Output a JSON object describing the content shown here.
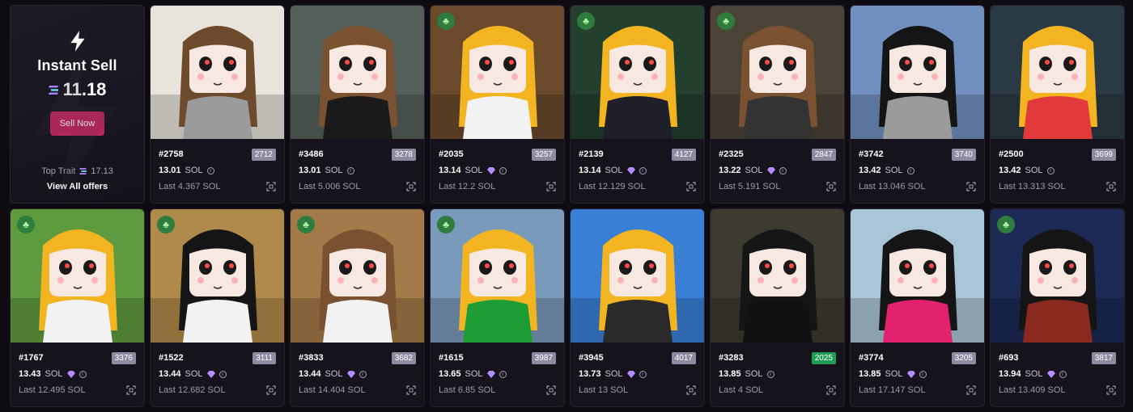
{
  "instant_sell": {
    "title": "Instant Sell",
    "price": "11.18",
    "button_label": "Sell Now",
    "top_trait_label": "Top Trait",
    "top_trait_value": "17.13",
    "view_all_label": "View All offers"
  },
  "colors": {
    "background": "#0e0b13",
    "card": "#17131d",
    "accent_button": "#c2265f",
    "rank_badge": "#8f8aa0",
    "rank_badge_green": "#1f9d55",
    "clover_badge": "#2e7d3e",
    "gem": "#b78cff"
  },
  "icons": {
    "bolt": "lightning-bolt-icon",
    "sol": "solana-icon",
    "gem": "diamond-icon",
    "info": "info-icon",
    "scan": "scan-icon",
    "clover": "clover-icon"
  },
  "cards": [
    {
      "id": "#2758",
      "rank": "2712",
      "price": "13.01",
      "unit": "SOL",
      "gem": false,
      "last": "Last 4.367 SOL",
      "clover": false,
      "bg": "#e8e4dc",
      "hair": "#6e4a2c",
      "shirt": "#9b9b9b"
    },
    {
      "id": "#3486",
      "rank": "3278",
      "price": "13.01",
      "unit": "SOL",
      "gem": false,
      "last": "Last 5.006 SOL",
      "clover": false,
      "bg": "#55605a",
      "hair": "#7a5232",
      "shirt": "#1a1a1a"
    },
    {
      "id": "#2035",
      "rank": "3257",
      "price": "13.14",
      "unit": "SOL",
      "gem": true,
      "last": "Last 12.2 SOL",
      "clover": true,
      "bg": "#6a4a2a",
      "hair": "#f3b422",
      "shirt": "#f2f2f2"
    },
    {
      "id": "#2139",
      "rank": "4127",
      "price": "13.14",
      "unit": "SOL",
      "gem": true,
      "last": "Last 12.129 SOL",
      "clover": true,
      "bg": "#23402e",
      "hair": "#f3b422",
      "shirt": "#1f1f2a"
    },
    {
      "id": "#2325",
      "rank": "2847",
      "price": "13.22",
      "unit": "SOL",
      "gem": true,
      "last": "Last 5.191 SOL",
      "clover": true,
      "bg": "#4a4336",
      "hair": "#7a5232",
      "shirt": "#333"
    },
    {
      "id": "#3742",
      "rank": "3740",
      "price": "13.42",
      "unit": "SOL",
      "gem": false,
      "last": "Last 13.046 SOL",
      "clover": false,
      "bg": "#6f8fbf",
      "hair": "#151515",
      "shirt": "#9b9b9b"
    },
    {
      "id": "#2500",
      "rank": "3699",
      "price": "13.42",
      "unit": "SOL",
      "gem": false,
      "last": "Last 13.313 SOL",
      "clover": false,
      "bg": "#2a3a44",
      "hair": "#f3b422",
      "shirt": "#e23a3a"
    },
    {
      "id": "#1767",
      "rank": "3376",
      "price": "13.43",
      "unit": "SOL",
      "gem": true,
      "last": "Last 12.495 SOL",
      "clover": true,
      "bg": "#5e9a3e",
      "hair": "#f3b422",
      "shirt": "#f2f2f2"
    },
    {
      "id": "#1522",
      "rank": "3111",
      "price": "13.44",
      "unit": "SOL",
      "gem": true,
      "last": "Last 12.682 SOL",
      "clover": true,
      "bg": "#b08a4a",
      "hair": "#151515",
      "shirt": "#f2f2f2"
    },
    {
      "id": "#3833",
      "rank": "3682",
      "price": "13.44",
      "unit": "SOL",
      "gem": true,
      "last": "Last 14.404 SOL",
      "clover": true,
      "bg": "#a37a48",
      "hair": "#7a5232",
      "shirt": "#f2f2f2"
    },
    {
      "id": "#1615",
      "rank": "3987",
      "price": "13.65",
      "unit": "SOL",
      "gem": true,
      "last": "Last 6.85 SOL",
      "clover": true,
      "bg": "#7a9abb",
      "hair": "#f3b422",
      "shirt": "#1f9d35"
    },
    {
      "id": "#3945",
      "rank": "4017",
      "price": "13.73",
      "unit": "SOL",
      "gem": true,
      "last": "Last 13 SOL",
      "clover": false,
      "bg": "#3a7fd6",
      "hair": "#f3b422",
      "shirt": "#2a2a2a"
    },
    {
      "id": "#3283",
      "rank": "2025",
      "price": "13.85",
      "unit": "SOL",
      "gem": false,
      "last": "Last 4 SOL",
      "clover": false,
      "bg": "#3d3a30",
      "hair": "#151515",
      "shirt": "#111",
      "green": true
    },
    {
      "id": "#3774",
      "rank": "3205",
      "price": "13.85",
      "unit": "SOL",
      "gem": true,
      "last": "Last 17.147 SOL",
      "clover": false,
      "bg": "#a9c6d6",
      "hair": "#151515",
      "shirt": "#e2216f"
    },
    {
      "id": "#693",
      "rank": "3817",
      "price": "13.94",
      "unit": "SOL",
      "gem": true,
      "last": "Last 13.409 SOL",
      "clover": true,
      "bg": "#1c2a55",
      "hair": "#151515",
      "shirt": "#8a2a1e"
    }
  ]
}
